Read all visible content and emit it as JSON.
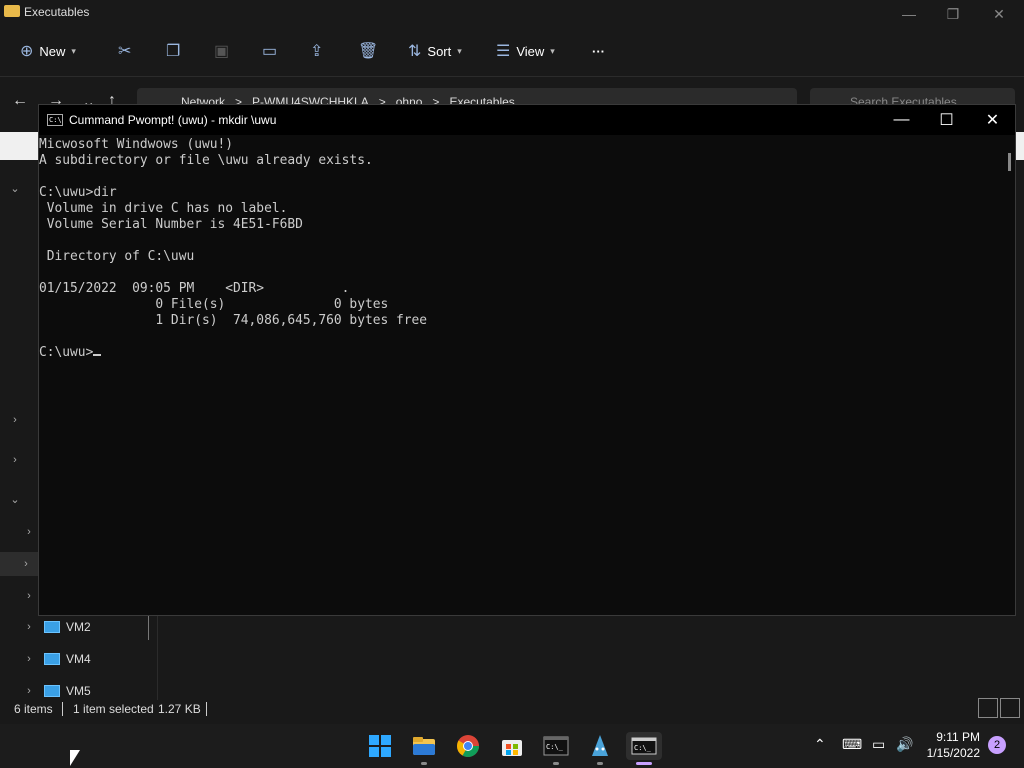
{
  "explorer": {
    "title": "Executables",
    "toolbar": {
      "new_label": "New",
      "sort_label": "Sort",
      "view_label": "View",
      "more_label": "···"
    },
    "address": {
      "segments": [
        "Network",
        ">",
        "P-WMU4SWCHHKLA",
        ">",
        "ohno",
        ">",
        "Executables"
      ]
    },
    "search_placeholder": "Search Executables",
    "tree": [
      {
        "label": "VM2"
      },
      {
        "label": "VM4"
      },
      {
        "label": "VM5"
      }
    ],
    "status": {
      "items": "6 items",
      "selected": "1 item selected",
      "size": "1.27 KB"
    }
  },
  "console": {
    "title": "Cummand Pwompt! (uwu) - mkdir \\uwu",
    "lines": [
      "Micwosoft Windwows (uwu!)",
      "A subdirectory or file \\uwu already exists.",
      "",
      "C:\\uwu>dir",
      " Volume in drive C has no label.",
      " Volume Serial Number is 4E51-F6BD",
      "",
      " Directory of C:\\uwu",
      "",
      "01/15/2022  09:05 PM    <DIR>          .",
      "               0 File(s)              0 bytes",
      "               1 Dir(s)  74,086,645,760 bytes free",
      ""
    ],
    "prompt": "C:\\uwu>"
  },
  "taskbar": {
    "apps": [
      "start-icon",
      "file-explorer-icon",
      "chrome-icon",
      "store-icon",
      "terminal-icon",
      "uwu-icon",
      "terminal-active-icon"
    ],
    "time": "9:11 PM",
    "date": "1/15/2022",
    "notifications": "2"
  }
}
